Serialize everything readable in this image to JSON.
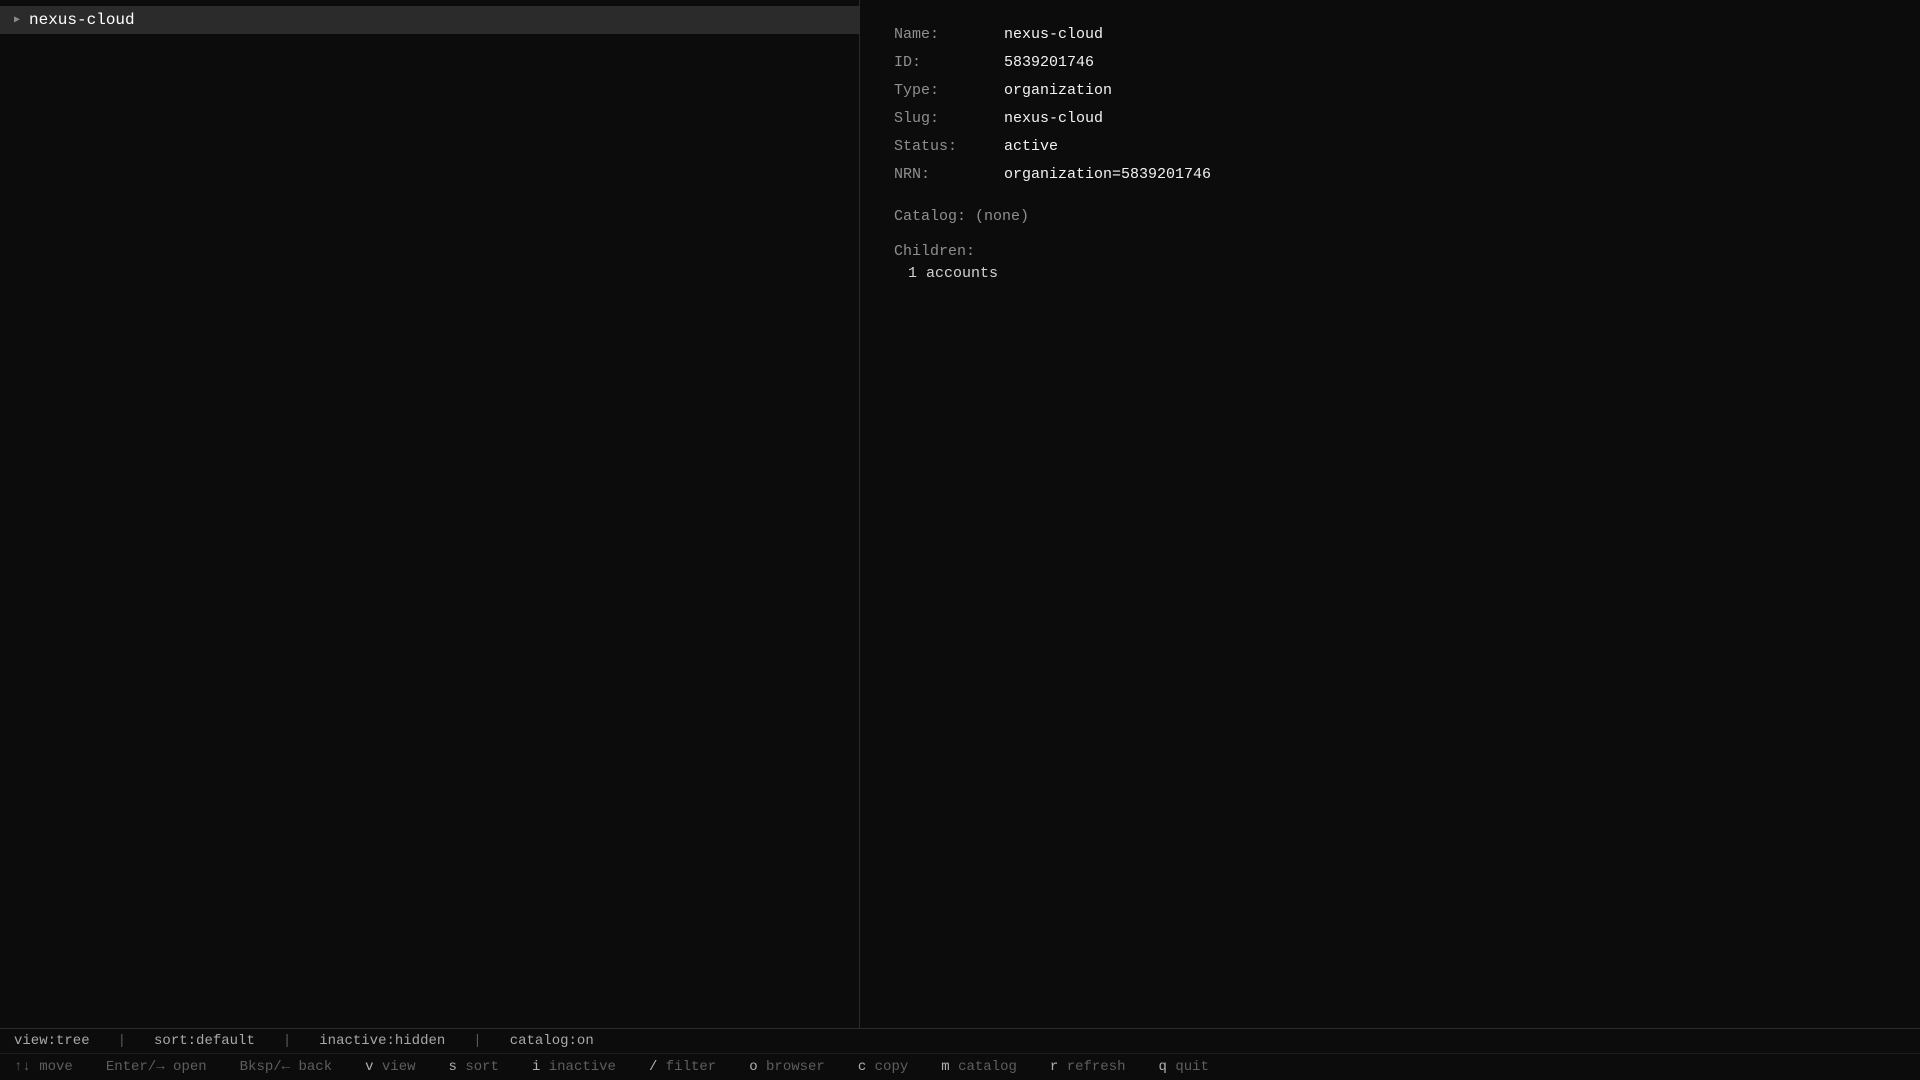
{
  "tree": {
    "items": [
      {
        "arrow": "▶",
        "label": "nexus-cloud"
      }
    ]
  },
  "details": {
    "name_label": "Name:",
    "name_value": "nexus-cloud",
    "id_label": "ID:",
    "id_value": "5839201746",
    "type_label": "Type:",
    "type_value": "organization",
    "slug_label": "Slug:",
    "slug_value": "nexus-cloud",
    "status_label": "Status:",
    "status_value": "active",
    "nrn_label": "NRN:",
    "nrn_value": "organization=5839201746",
    "catalog_text": "Catalog: (none)",
    "children_label": "Children:",
    "children_item": "1 accounts"
  },
  "status": {
    "view": "view:tree",
    "sort": "sort:default",
    "inactive": "inactive:hidden",
    "catalog": "catalog:on",
    "separator": "|"
  },
  "keys": [
    {
      "key": "↑↓",
      "action": "move"
    },
    {
      "key": "Enter/→",
      "action": "open"
    },
    {
      "key": "Bksp/←",
      "action": "back"
    },
    {
      "key": "v",
      "action": "view"
    },
    {
      "key": "s",
      "action": "sort"
    },
    {
      "key": "i",
      "action": "inactive"
    },
    {
      "key": "/",
      "action": "filter"
    },
    {
      "key": "o",
      "action": "browser"
    },
    {
      "key": "c",
      "action": "copy"
    },
    {
      "key": "m",
      "action": "catalog"
    },
    {
      "key": "r",
      "action": "refresh"
    },
    {
      "key": "q",
      "action": "quit"
    }
  ],
  "colors": {
    "background": "#0c0c0c",
    "selection": "#2b2b2b",
    "label": "#8f8f8f",
    "value": "#f2f2f2"
  }
}
